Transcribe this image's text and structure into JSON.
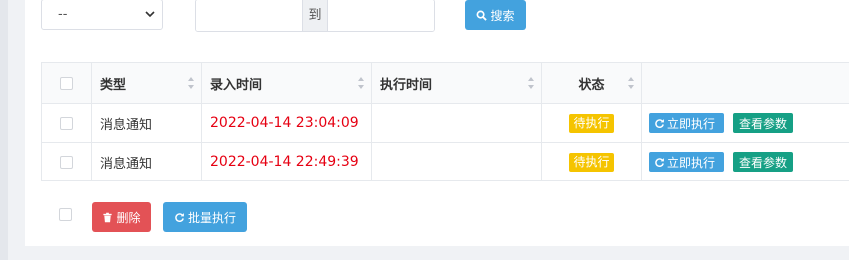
{
  "filters": {
    "select_value": "--",
    "range_separator": "到",
    "range_start": "",
    "range_end": "",
    "search_label": "搜索"
  },
  "table": {
    "columns": [
      "类型",
      "录入时间",
      "执行时间",
      "状态",
      ""
    ],
    "rows": [
      {
        "type": "消息通知",
        "entry_time": "2022-04-14 23:04:09",
        "exec_time": "",
        "status": "待执行",
        "exec_btn": "立即执行",
        "view_btn": "查看参数"
      },
      {
        "type": "消息通知",
        "entry_time": "2022-04-14 22:49:39",
        "exec_time": "",
        "status": "待执行",
        "exec_btn": "立即执行",
        "view_btn": "查看参数"
      }
    ]
  },
  "footer": {
    "delete_label": "删除",
    "batch_label": "批量执行"
  },
  "colors": {
    "primary": "#43a2de",
    "danger": "#e35256",
    "success": "#16a085",
    "warning": "#f5c400",
    "time_red": "#e60012"
  },
  "icons": [
    "chevron-down-icon",
    "search-icon",
    "sort-icon",
    "refresh-icon",
    "trash-icon"
  ]
}
